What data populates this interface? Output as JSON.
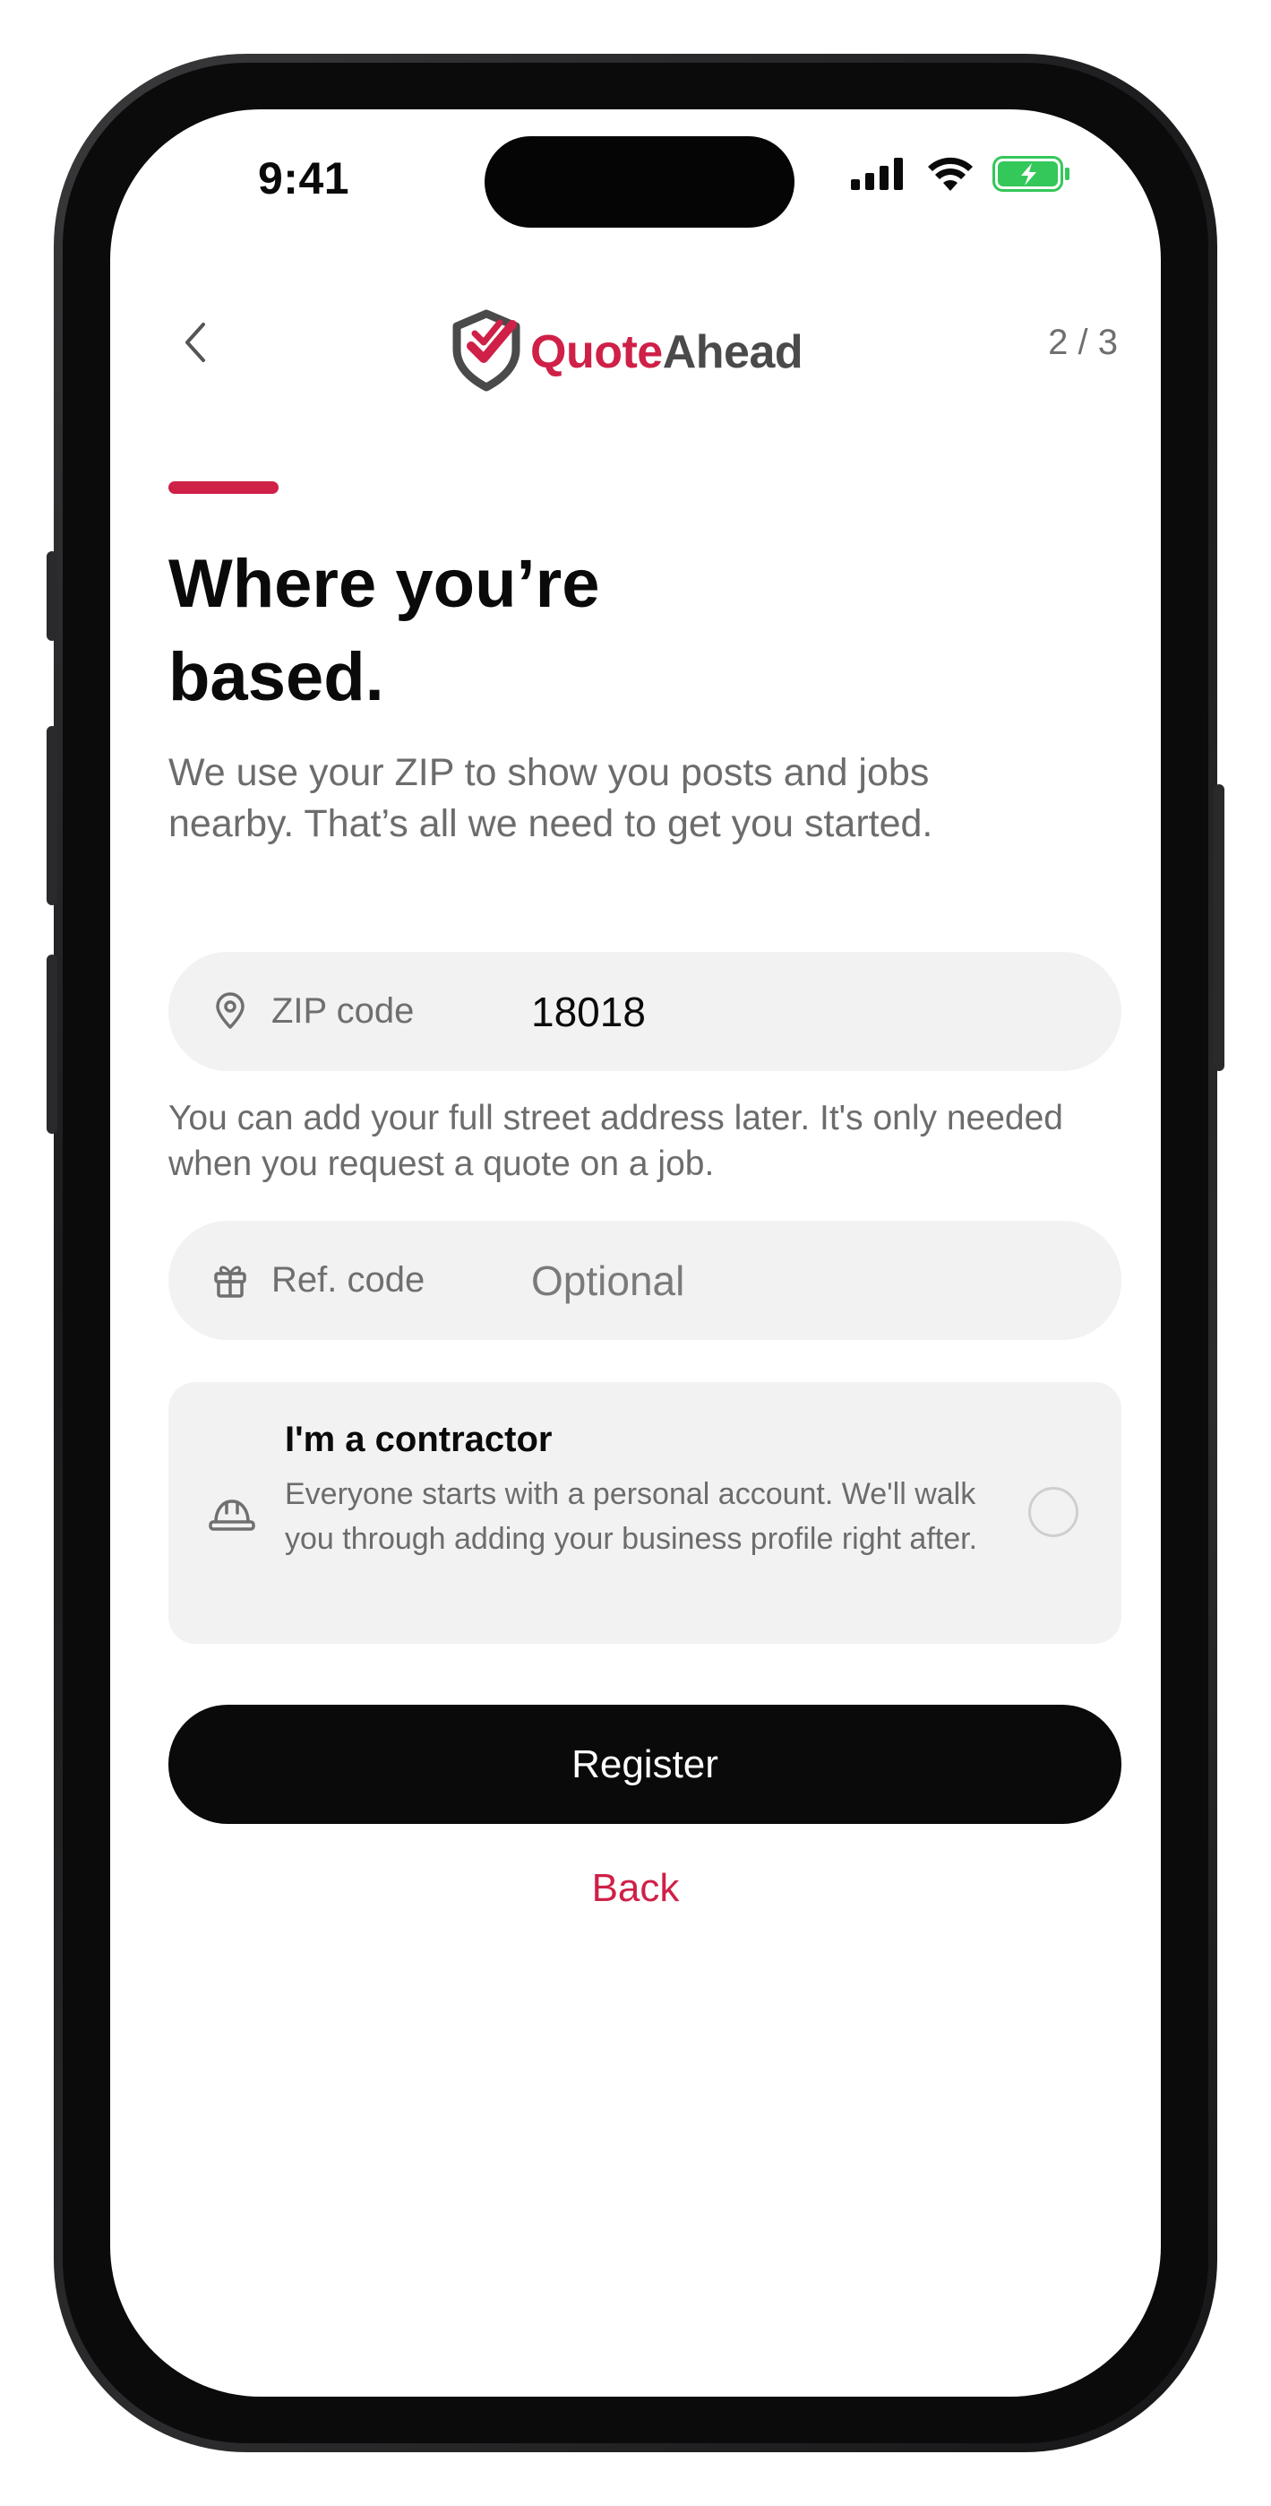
{
  "status_bar": {
    "time": "9:41",
    "icons": [
      "cellular-signal-icon",
      "wifi-icon",
      "battery-charging-icon"
    ],
    "battery_color": "#34c759"
  },
  "header": {
    "back_icon": "chevron-left-icon",
    "logo": {
      "icon": "shield-check-logo-icon",
      "text_part1": "Quote",
      "text_part2": "Ahead"
    },
    "step": "2 / 3"
  },
  "main": {
    "title": "Where you’re based.",
    "subtitle": "We use your ZIP to show you posts and jobs nearby. That’s all we need to get you started.",
    "zip_field": {
      "icon": "location-pin-icon",
      "label": "ZIP code",
      "value": "18018"
    },
    "zip_helper": "You can add your full street address later. It's only needed when you request a quote on a job.",
    "ref_field": {
      "icon": "gift-icon",
      "label": "Ref. code",
      "placeholder": "Optional"
    },
    "contractor": {
      "icon": "hard-hat-icon",
      "title": "I'm a contractor",
      "description": "Everyone starts with a personal account. We'll walk you through adding your business profile right after.",
      "selected": false
    },
    "register_label": "Register",
    "back_label": "Back"
  },
  "colors": {
    "accent": "#cf2047",
    "primary_button": "#0a0a0a",
    "field_background": "#f2f2f2",
    "muted_text": "#6c6c6c"
  }
}
